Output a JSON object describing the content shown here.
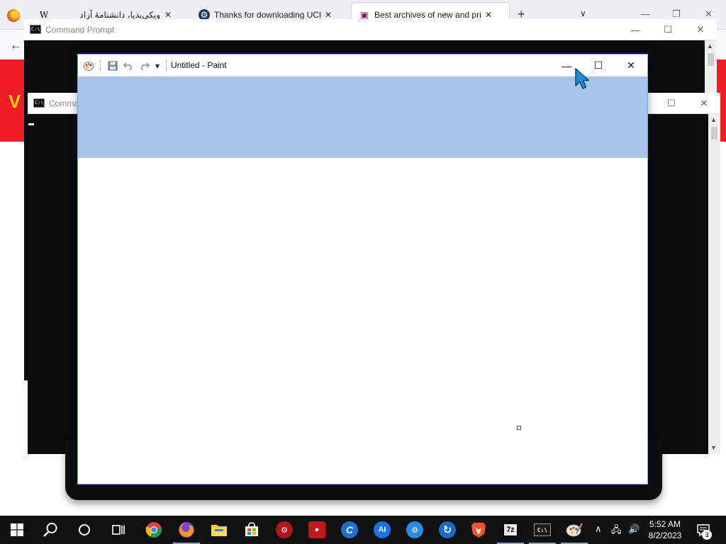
{
  "browser": {
    "tabs": [
      {
        "icon": "wikipedia-icon",
        "icon_glyph": "W",
        "title": "ویکی‌پدیا، دانشنامهٔ آزاد",
        "close": "✕"
      },
      {
        "icon": "uchecker-icon",
        "icon_glyph": "⚙",
        "title": "Thanks for downloading UChe",
        "close": "✕"
      },
      {
        "icon": "site-icon",
        "icon_glyph": "▣",
        "title": "Best archives of new and privat",
        "close": "✕",
        "active": true
      }
    ],
    "new_tab": "+",
    "list_tabs": "∨",
    "minimize": "—",
    "restore": "❐",
    "close": "✕",
    "back": "←",
    "banner_logo": "V"
  },
  "cmd_back": {
    "title": "Command Prompt",
    "icon_text": "C:\\",
    "minimize": "—",
    "maximize": "☐",
    "close": "✕"
  },
  "cmd_front": {
    "title": "Comma",
    "icon_text": "C:\\",
    "maximize": "☐",
    "close": "✕",
    "scroll_up": "▲",
    "scroll_down": "▼"
  },
  "paint": {
    "title": "Untitled - Paint",
    "minimize": "—",
    "maximize": "☐",
    "close": "✕",
    "qa_menu": "▾"
  },
  "taskbar": {
    "start": "⊞",
    "search": "⚲",
    "cortana": "○",
    "task_view": "⧉",
    "apps": [
      {
        "name": "chrome",
        "label": "",
        "color": "#ea4335"
      },
      {
        "name": "firefox",
        "label": "",
        "color": "#ff7139"
      },
      {
        "name": "file-explorer",
        "label": "",
        "color": "#f4c430"
      },
      {
        "name": "microsoft-store",
        "label": "",
        "color": "#0078d4"
      },
      {
        "name": "app-red-gear",
        "label": "⚙",
        "color": "#b3141b"
      },
      {
        "name": "screen-recorder",
        "label": "●",
        "color": "#c4161c"
      },
      {
        "name": "ccleaner",
        "label": "C",
        "color": "#1e6fd0"
      },
      {
        "name": "ai-chat",
        "label": "AI",
        "color": "#1a73e8"
      },
      {
        "name": "settings-globe",
        "label": "⚙",
        "color": "#2b8be0"
      },
      {
        "name": "sync-app",
        "label": "↻",
        "color": "#1769c2"
      },
      {
        "name": "brave",
        "label": "B",
        "color": "#fb542b"
      },
      {
        "name": "7zip",
        "label": "7z",
        "color": "#222222"
      },
      {
        "name": "command-prompt",
        "label": "C:\\",
        "color": "#333333"
      },
      {
        "name": "paint",
        "label": "🎨",
        "color": "#7aa7d8"
      }
    ],
    "tray_chevron": "∧",
    "tray_network": "🖧",
    "tray_volume": "🔊",
    "clock_time": "5:52 AM",
    "clock_date": "8/2/2023",
    "notification_count": "3"
  }
}
